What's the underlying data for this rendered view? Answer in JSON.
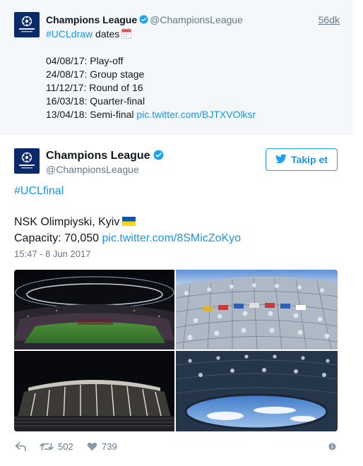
{
  "parent_tweet": {
    "account_name": "Champions League",
    "handle": "@ChampionsLeague",
    "time": "56dk",
    "hashtag": "#UCLdraw",
    "headline_rest": " dates",
    "lines": [
      "04/08/17: Play-off",
      "24/08/17: Group stage",
      "11/12/17: Round of 16",
      "16/03/18: Quarter-final",
      "13/04/18: Semi-final "
    ],
    "link": "pic.twitter.com/BJTXVOlksr"
  },
  "main_tweet": {
    "account_name": "Champions League",
    "handle": "@ChampionsLeague",
    "follow_label": "Takip et",
    "hashtag": "#UCLfinal",
    "venue": "NSK Olimpiyski, Kyiv",
    "capacity_text": "Capacity: 70,050 ",
    "link": "pic.twitter.com/8SMicZoKyo",
    "timestamp": "15:47 - 8 Jun 2017",
    "retweets": "502",
    "likes": "739"
  },
  "icons": {
    "verified": "verified-badge-icon",
    "calendar": "calendar-icon",
    "flag": "ukraine-flag-icon",
    "follow": "twitter-bird-icon",
    "reply": "reply-icon",
    "retweet": "retweet-icon",
    "like": "heart-icon",
    "more": "info-icon"
  },
  "colors": {
    "link": "#1b95e0",
    "follow_border": "#1da1f2",
    "verified": "#1da1f2",
    "muted": "#657786",
    "parent_bg": "#f5f8fa",
    "avatar_bg": "#0a2a6b",
    "flag_blue": "#0057b7",
    "flag_yellow": "#ffd700"
  }
}
